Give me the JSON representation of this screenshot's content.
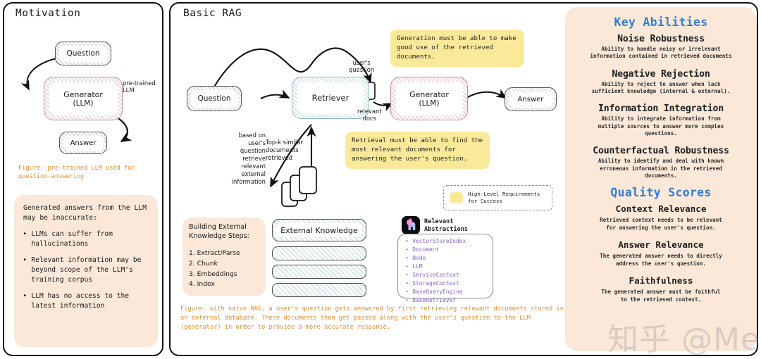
{
  "motivation": {
    "title": "Motivation",
    "nodes": {
      "question": "Question",
      "generator_line1": "Generator",
      "generator_line2": "(LLM)",
      "answer": "Answer"
    },
    "edge_label": "pre-trained\nLLM",
    "figure_caption": "Figure: pre-trained LLM used for question-answering",
    "callout": {
      "heading": "Generated answers from the LLM may be inaccurate:",
      "bullets": [
        "LLMs can suffer from hallucinations",
        "Relevant information may be beyond scope of the LLM's training corpus",
        "LLM has no access to the latest information"
      ]
    }
  },
  "basic_rag": {
    "title": "Basic RAG",
    "nodes": {
      "question": "Question",
      "retriever": "Retriever",
      "generator_line1": "Generator",
      "generator_line2": "(LLM)",
      "answer": "Answer",
      "external_knowledge": "External Knowledge"
    },
    "edge_labels": {
      "users_question": "user's\nquestion",
      "relevant_docs": "relevant\ndocs",
      "based_on": "based on\nuser's\nquestion\nretrieve\nrelevant\nexternal\ninformation",
      "topk": "Top-k similar\ndocuments\nretrieved"
    },
    "notes": {
      "generation": "Generation must be able to make good use of the retrieved documents.",
      "retrieval": "Retrieval must be able to find the most relevant documents for answering the user's question."
    },
    "legend": {
      "line1": "High-Level Requirements",
      "line2": "for Success"
    },
    "steps_card": {
      "heading_line1": "Building External",
      "heading_line2": "Knowledge Steps:",
      "items": [
        "1. Extract/Parse",
        "2. Chunk",
        "3. Embeddings",
        "4. Index"
      ]
    },
    "abstractions": {
      "title_line1": "Relevant",
      "title_line2": "Abstractions",
      "logo_name": "llamaindex-logo",
      "items": [
        "VectorStoreIndex",
        "Document",
        "Node",
        "LLM",
        "ServiceContext",
        "StorageContext",
        "BaseQueryEngine",
        "BaseRetriever"
      ]
    },
    "figure_caption": "Figure: with naive RAG, a user's question gets answered by first retrieving relevant documents stored in an external database. These documents then get passed along with the user's question to the LLM (generator) in order to provide a more accurate response."
  },
  "abilities": {
    "key_abilities_heading": "Key Abilities",
    "key_abilities": [
      {
        "title": "Noise Robustness",
        "desc": "Ability to handle noisy or irrelevant information contained in retrieved documents"
      },
      {
        "title": "Negative Rejection",
        "desc": "Ability to reject to answer when lack sufficient knowledge (internal & external)."
      },
      {
        "title": "Information Integration",
        "desc": "Ability to integrate information from multiple sources to answer more complex questions."
      },
      {
        "title": "Counterfactual Robustness",
        "desc": "Ability to identify and deal with known erroneous information in the retrieved documents."
      }
    ],
    "quality_scores_heading": "Quality Scores",
    "quality_scores": [
      {
        "title": "Context Relevance",
        "desc": "Retrieved context needs to be relevant for answering the user's question."
      },
      {
        "title": "Answer Relevance",
        "desc": "The generated answer needs to directly address the user's question."
      },
      {
        "title": "Faithfulness",
        "desc": "The generated answer must be faithful to the retrieved context."
      }
    ]
  },
  "watermark": "知乎 @Meta",
  "colors": {
    "accent_blue": "#2f7ed8",
    "caption_orange": "#e2902f",
    "peach": "#fbe8d8",
    "yellow": "#fbe99a",
    "purple": "#8a63d2"
  }
}
